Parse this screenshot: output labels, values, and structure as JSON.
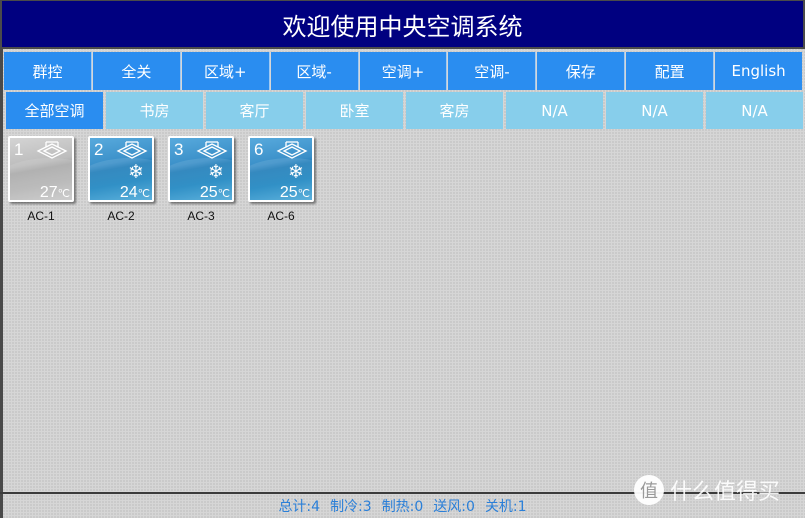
{
  "header": {
    "title": "欢迎使用中央空调系统"
  },
  "toolbar": {
    "buttons": [
      "群控",
      "全关",
      "区域+",
      "区域-",
      "空调+",
      "空调-",
      "保存",
      "配置",
      "English"
    ]
  },
  "tabs": {
    "active_index": 0,
    "items": [
      "全部空调",
      "书房",
      "客厅",
      "卧室",
      "客房",
      "N/A",
      "N/A",
      "N/A"
    ]
  },
  "units": [
    {
      "number": "1",
      "label": "AC-1",
      "temp": "27",
      "unit": "℃",
      "state": "off",
      "mode_icon": ""
    },
    {
      "number": "2",
      "label": "AC-2",
      "temp": "24",
      "unit": "℃",
      "state": "cool",
      "mode_icon": "❄"
    },
    {
      "number": "3",
      "label": "AC-3",
      "temp": "25",
      "unit": "℃",
      "state": "cool",
      "mode_icon": "❄"
    },
    {
      "number": "6",
      "label": "AC-6",
      "temp": "25",
      "unit": "℃",
      "state": "cool",
      "mode_icon": "❄"
    }
  ],
  "status": {
    "total": "总计:4",
    "cool": "制冷:3",
    "heat": "制热:0",
    "fan": "送风:0",
    "off": "关机:1"
  },
  "watermark": {
    "badge": "值",
    "text": "什么值得买"
  },
  "colors": {
    "title_bg": "#000080",
    "button_blue": "#2a8df0",
    "tab_light": "#87ceeb",
    "status_text": "#2a7fd8"
  }
}
